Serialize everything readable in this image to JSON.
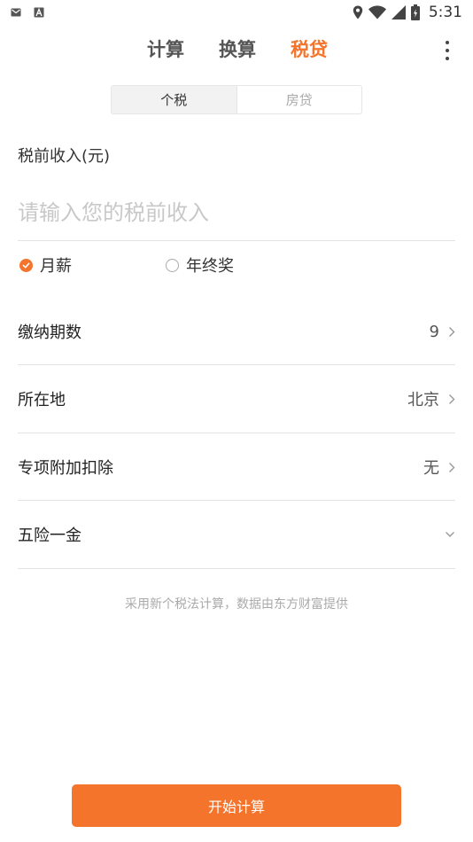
{
  "status_bar": {
    "time": "5:31",
    "left_icons": [
      "mail-icon",
      "text-a-icon"
    ],
    "right_icons": [
      "location-icon",
      "wifi-icon",
      "signal-icon",
      "battery-icon"
    ]
  },
  "top_tabs": [
    {
      "label": "计算",
      "active": false
    },
    {
      "label": "换算",
      "active": false
    },
    {
      "label": "税贷",
      "active": true
    }
  ],
  "segment": [
    {
      "label": "个税",
      "active": true
    },
    {
      "label": "房贷",
      "active": false
    }
  ],
  "income": {
    "label": "税前收入(元)",
    "placeholder": "请输入您的税前收入",
    "value": ""
  },
  "income_type": [
    {
      "label": "月薪",
      "checked": true
    },
    {
      "label": "年终奖",
      "checked": false
    }
  ],
  "rows": [
    {
      "label": "缴纳期数",
      "value": "9",
      "indicator": "chevron-right-icon"
    },
    {
      "label": "所在地",
      "value": "北京",
      "indicator": "chevron-right-icon"
    },
    {
      "label": "专项附加扣除",
      "value": "无",
      "indicator": "chevron-right-icon"
    },
    {
      "label": "五险一金",
      "value": "",
      "indicator": "chevron-down-icon"
    }
  ],
  "footnote": "采用新个税法计算，数据由东方财富提供",
  "start_button": "开始计算",
  "colors": {
    "accent": "#f5742b",
    "text_primary": "#222222",
    "text_muted": "#aaaaaa",
    "divider": "#e3e3e3"
  }
}
